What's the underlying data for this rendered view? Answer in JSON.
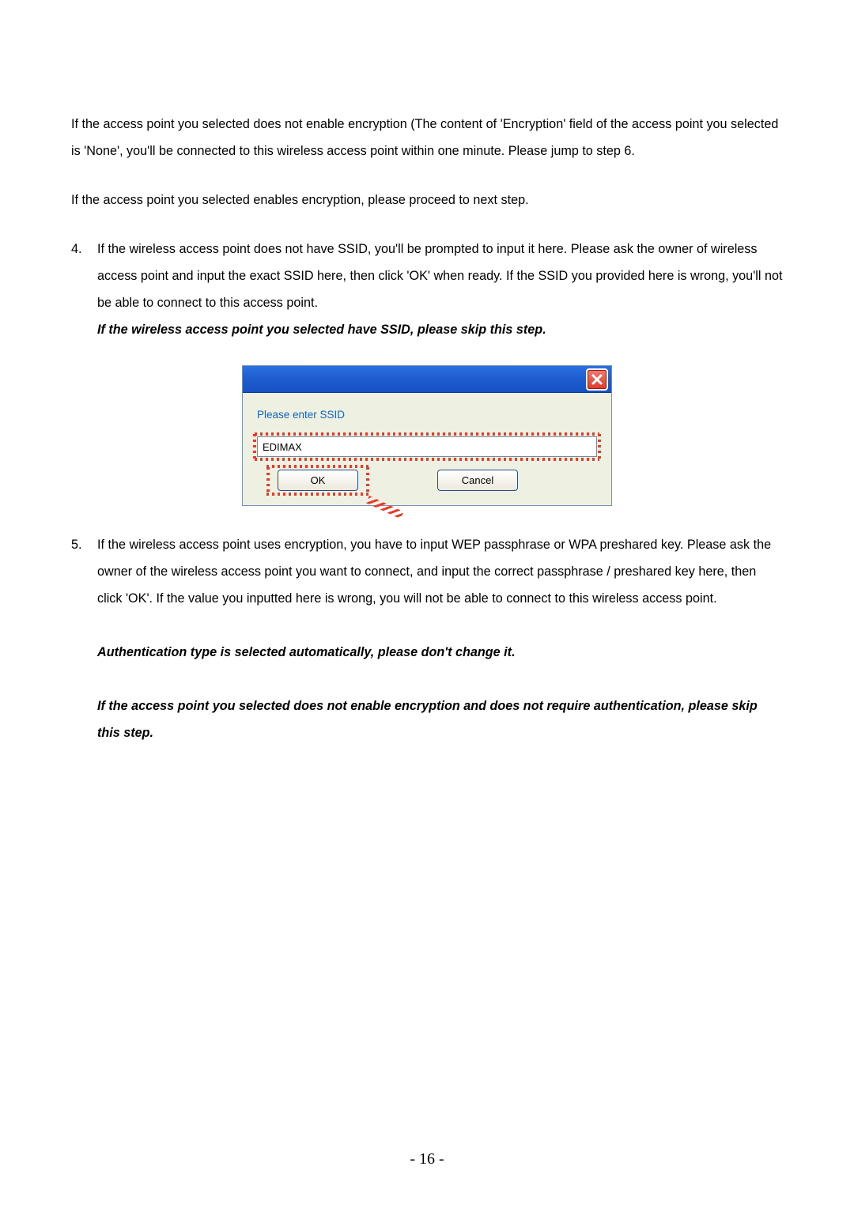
{
  "paragraphs": {
    "p1": "If the access point you selected does not enable encryption (The content of 'Encryption' field of the access point you selected is 'None', you'll be connected to this wireless access point within one minute. Please jump to step 6.",
    "p2": "If the access point you selected enables encryption, please proceed to next step."
  },
  "steps": {
    "s4": {
      "num": "4.",
      "body": "If the wireless access point does not have SSID, you'll be prompted to input it here. Please ask the owner of wireless access point and input the exact SSID here, then click 'OK' when ready. If the SSID you provided here is wrong, you'll not be able to connect to this access point.",
      "note": "If the wireless access point you selected have SSID, please skip this step."
    },
    "s5": {
      "num": "5.",
      "body": "If the wireless access point uses encryption, you have to input WEP passphrase or WPA preshared key. Please ask the owner of the wireless access point you want to connect, and input the correct passphrase / preshared key here, then click 'OK'. If the value you inputted here is wrong, you will not be able to connect to this wireless access point.",
      "note1": "Authentication type is selected automatically, please don't change it.",
      "note2": "If the access point you selected does not enable encryption and does not require authentication, please skip this step."
    }
  },
  "dialog": {
    "label": "Please enter SSID",
    "input_value": "EDIMAX",
    "ok": "OK",
    "cancel": "Cancel"
  },
  "footer": "- 16 -"
}
